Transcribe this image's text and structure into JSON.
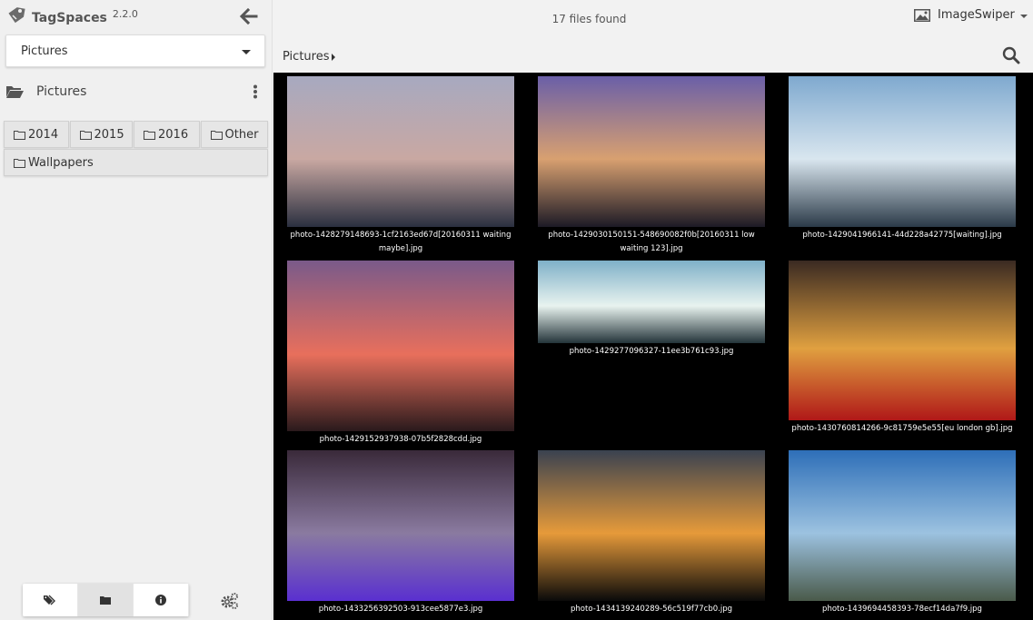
{
  "app": {
    "name": "TagSpaces",
    "version": "2.2.0"
  },
  "location": {
    "selected": "Pictures"
  },
  "directory": {
    "title": "Pictures",
    "subfolders": [
      "2014",
      "2015",
      "2016",
      "Other",
      "Wallpapers"
    ]
  },
  "topbar": {
    "file_count": "17 files found",
    "perspective": "ImageSwiper"
  },
  "breadcrumb": {
    "current": "Pictures"
  },
  "files": [
    {
      "name": "photo-1428279148693-1cf2163ed67d[20160311 waiting maybe].jpg",
      "palette": [
        "#a7a9c0",
        "#c9a8a2",
        "#2b3040"
      ]
    },
    {
      "name": "photo-1429030150151-548690082f0b[20160311 low waiting 123].jpg",
      "palette": [
        "#6a5fa8",
        "#d8a070",
        "#1c1a26"
      ]
    },
    {
      "name": "photo-1429041966141-44d228a42775[waiting].jpg",
      "palette": [
        "#7fa9cf",
        "#d9e6ef",
        "#2b3a48"
      ]
    },
    {
      "name": "photo-1429152937938-07b5f2828cdd.jpg",
      "palette": [
        "#7a5a8a",
        "#e86f5c",
        "#2a1a1c"
      ]
    },
    {
      "name": "photo-1429277096327-11ee3b761c93.jpg",
      "palette": [
        "#7fb0c8",
        "#e8f3ef",
        "#24343a"
      ]
    },
    {
      "name": "photo-1430760814266-9c81759e5e55[eu london gb].jpg",
      "palette": [
        "#3a2a22",
        "#e0a040",
        "#b01818"
      ]
    },
    {
      "name": "photo-1433256392503-913cee5877e3.jpg",
      "palette": [
        "#3a2a3a",
        "#8a7aa0",
        "#5a30d0"
      ]
    },
    {
      "name": "photo-1434139240289-56c519f77cb0.jpg",
      "palette": [
        "#3a4250",
        "#e69a3a",
        "#0a0a0a"
      ]
    },
    {
      "name": "photo-1439694458393-78ecf14da7f9.jpg",
      "palette": [
        "#2e6fb8",
        "#9cc2e0",
        "#4a5a4a"
      ]
    }
  ],
  "sidebar_tabs": [
    {
      "id": "tags",
      "icon": "tags-icon"
    },
    {
      "id": "folders",
      "icon": "folder-icon"
    },
    {
      "id": "info",
      "icon": "info-icon"
    }
  ]
}
